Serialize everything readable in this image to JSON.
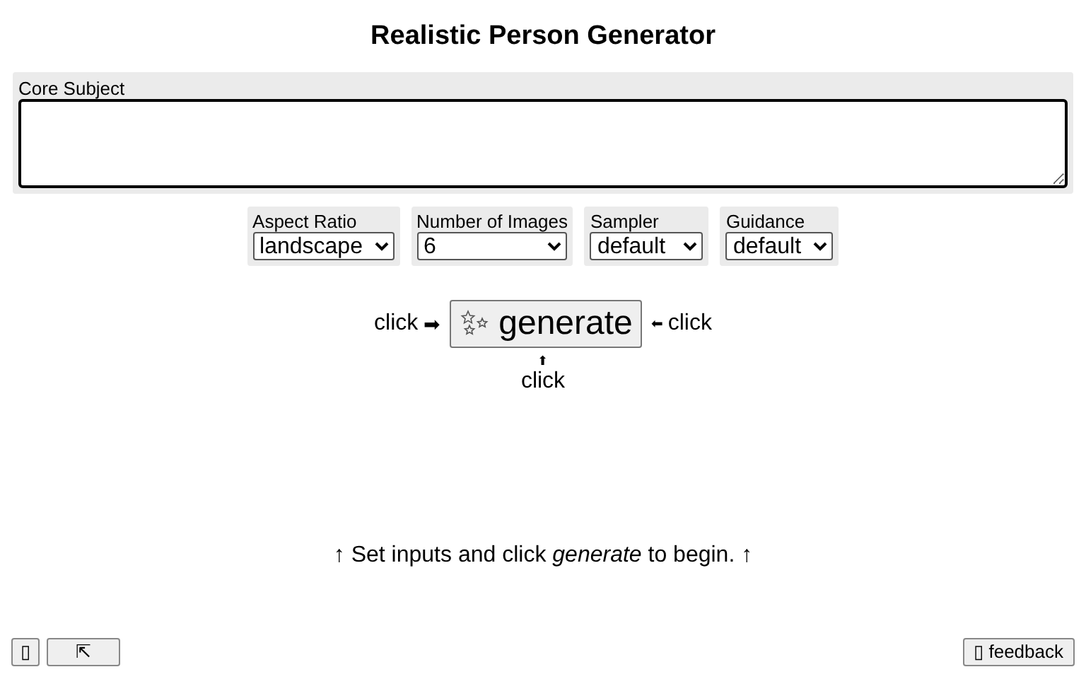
{
  "title": "Realistic Person Generator",
  "core_subject": {
    "label": "Core Subject"
  },
  "options": [
    {
      "label": "Aspect Ratio",
      "value": "landscape"
    },
    {
      "label": "Number of Images",
      "value": "6"
    },
    {
      "label": "Sampler",
      "value": "default"
    },
    {
      "label": "Guidance",
      "value": "default"
    }
  ],
  "generate": {
    "label": "generate",
    "left_hint": "click",
    "left_arrow": "➡",
    "right_arrow": "⬅",
    "right_hint": "click",
    "bottom_arrow": "⬆",
    "bottom_hint": "click"
  },
  "message": "↑ Set inputs and click *generate* to begin. ↑",
  "footer": {
    "left_buttons": [
      "▯",
      "⇱"
    ],
    "feedback": "▯ feedback"
  }
}
